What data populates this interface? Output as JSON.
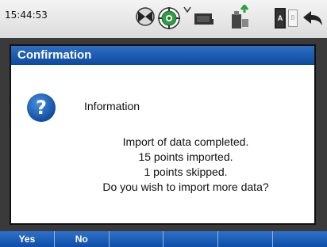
{
  "status_bar": {
    "time": "15:44:53",
    "icons": [
      "satellite-status-icon",
      "target-icon",
      "signal-icon",
      "radio-icon",
      "usb-upload-icon",
      "battery-a-icon",
      "battery-b-icon",
      "back-arrow-icon"
    ],
    "battery_labels": {
      "a": "A",
      "b": "B"
    }
  },
  "dialog": {
    "title": "Confirmation",
    "icon": "question-icon",
    "heading": "Information",
    "message_lines": [
      "Import of data completed.",
      "15 points imported.",
      "1 points skipped.",
      "Do you wish to import more data?"
    ]
  },
  "softkeys": {
    "yes": "Yes",
    "no": "No",
    "empty": [
      "",
      "",
      "",
      ""
    ]
  },
  "colors": {
    "accent_blue": "#0c4a9e",
    "status_green": "#2ea043"
  }
}
